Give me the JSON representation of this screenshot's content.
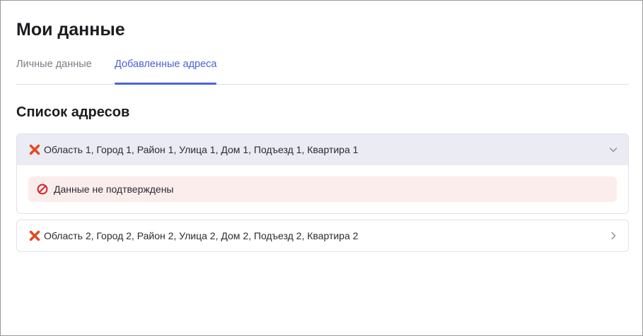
{
  "page": {
    "title": "Мои данные"
  },
  "tabs": [
    {
      "label": "Личные данные",
      "active": false
    },
    {
      "label": "Добавленные адреса",
      "active": true
    }
  ],
  "addresses_section": {
    "title": "Список адресов",
    "items": [
      {
        "address": "Область 1, Город 1, Район 1, Улица 1, Дом 1, Подъезд 1, Квартира 1",
        "status_icon": "x-mark-icon",
        "expanded": true,
        "toggle_icon": "chevron-down-icon",
        "alert": {
          "icon": "ban-icon",
          "text": "Данные не подтверждены"
        }
      },
      {
        "address": "Область 2, Город 2, Район 2, Улица 2, Дом 2, Подъезд 2, Квартира 2",
        "status_icon": "x-mark-icon",
        "expanded": false,
        "toggle_icon": "chevron-right-icon"
      }
    ]
  },
  "colors": {
    "accent": "#4a63d8",
    "error_icon": "#e8461d",
    "alert_background": "#fceded",
    "ban_icon": "#d81f26",
    "expanded_header": "#ebebf3"
  }
}
